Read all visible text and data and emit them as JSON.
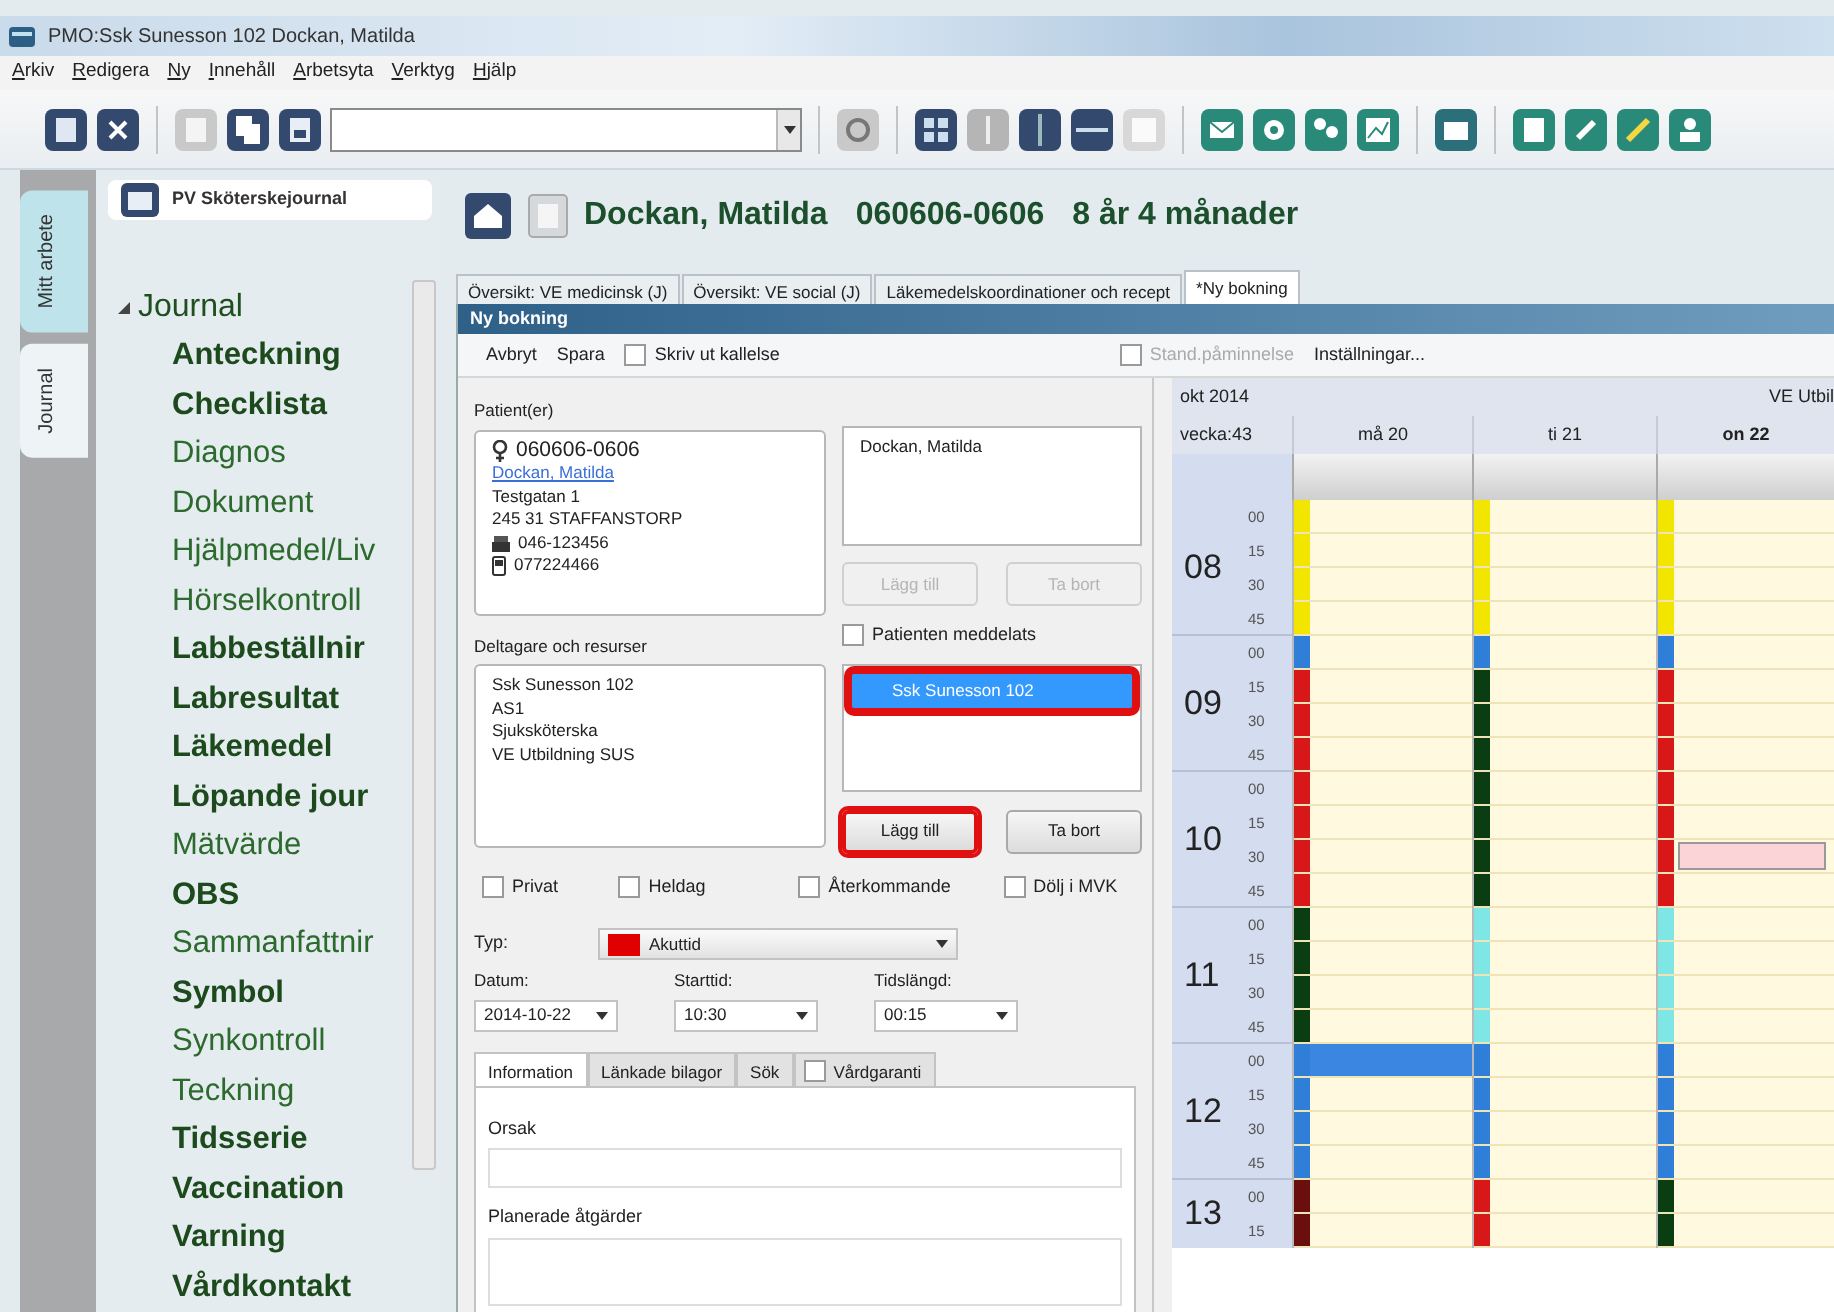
{
  "window": {
    "title": "PMO:Ssk Sunesson 102  Dockan, Matilda"
  },
  "menu": [
    "Arkiv",
    "Redigera",
    "Ny",
    "Innehåll",
    "Arbetsyta",
    "Verktyg",
    "Hjälp"
  ],
  "side_tabs": [
    {
      "label": "Mitt arbete",
      "selected": false
    },
    {
      "label": "Journal",
      "selected": true
    }
  ],
  "sidebar": {
    "title": "PV Sköterskejournal",
    "tree": [
      {
        "label": "Journal",
        "expanded": true,
        "children": [
          {
            "label": "Anteckning",
            "bold": true
          },
          {
            "label": "Checklista",
            "bold": true
          },
          {
            "label": "Diagnos",
            "bold": false
          },
          {
            "label": "Dokument",
            "bold": false
          },
          {
            "label": "Hjälpmedel/Liv",
            "bold": false
          },
          {
            "label": "Hörselkontroll",
            "bold": false
          },
          {
            "label": "Labbeställnir",
            "bold": true
          },
          {
            "label": "Labresultat",
            "bold": true
          },
          {
            "label": "Läkemedel",
            "bold": true
          },
          {
            "label": "Löpande jour",
            "bold": true
          },
          {
            "label": "Mätvärde",
            "bold": false
          },
          {
            "label": "OBS",
            "bold": true
          },
          {
            "label": "Sammanfattnir",
            "bold": false
          },
          {
            "label": "Symbol",
            "bold": true
          },
          {
            "label": "Synkontroll",
            "bold": false
          },
          {
            "label": "Teckning",
            "bold": false
          },
          {
            "label": "Tidsserie",
            "bold": true
          },
          {
            "label": "Vaccination",
            "bold": true
          },
          {
            "label": "Varning",
            "bold": true
          },
          {
            "label": "Vårdkontakt",
            "bold": true
          }
        ]
      }
    ]
  },
  "patient_header": {
    "name": "Dockan, Matilda",
    "id": "060606-0606",
    "age": "8 år 4 månader"
  },
  "tabs": [
    {
      "label": "Översikt: VE medicinsk (J)",
      "selected": false
    },
    {
      "label": "Översikt: VE social (J)",
      "selected": false
    },
    {
      "label": "Läkemedelskoordinationer och recept",
      "selected": false
    },
    {
      "label": "*Ny bokning",
      "selected": true
    }
  ],
  "dialog": {
    "title": "Ny bokning",
    "toolbar": [
      {
        "kind": "button",
        "label": "Avbryt"
      },
      {
        "kind": "button",
        "label": "Spara"
      },
      {
        "kind": "checkbox",
        "label": "Skriv ut kallelse",
        "checked": false,
        "disabled": false
      },
      {
        "kind": "checkbox",
        "label": "Stand.påminnelse",
        "checked": false,
        "disabled": true
      },
      {
        "kind": "button",
        "label": "Inställningar..."
      }
    ],
    "patients_label": "Patient(er)",
    "patient": {
      "id": "060606-0606",
      "name": "Dockan, Matilda",
      "address": "Testgatan 1",
      "city": "245 31 STAFFANSTORP",
      "phone": "046-123456",
      "mobile": "077224466"
    },
    "patient_list": [
      "Dockan, Matilda"
    ],
    "patient_buttons": [
      {
        "label": "Lägg till",
        "disabled": true,
        "highlighted": false
      },
      {
        "label": "Ta bort",
        "disabled": true,
        "highlighted": false
      }
    ],
    "patient_notified": {
      "label": "Patienten meddelats",
      "checked": false
    },
    "participants_label": "Deltagare och resurser",
    "participants": [
      "Ssk Sunesson 102",
      "AS1",
      "Sjuksköterska",
      "VE Utbildning SUS"
    ],
    "resource_list": [
      {
        "label": "Ssk Sunesson 102",
        "selected": true,
        "highlighted": true
      }
    ],
    "resource_buttons": [
      {
        "label": "Lägg till",
        "disabled": false,
        "highlighted": true
      },
      {
        "label": "Ta bort",
        "disabled": false,
        "highlighted": false
      }
    ],
    "options": [
      {
        "label": "Privat",
        "checked": false
      },
      {
        "label": "Heldag",
        "checked": false
      },
      {
        "label": "Återkommande",
        "checked": false
      },
      {
        "label": "Dölj i MVK",
        "checked": false
      }
    ],
    "type": {
      "label": "Typ:",
      "value": "Akuttid",
      "color": "#e00000"
    },
    "datetime": [
      {
        "label": "Datum:",
        "value": "2014-10-22"
      },
      {
        "label": "Starttid:",
        "value": "10:30"
      },
      {
        "label": "Tidslängd:",
        "value": "00:15"
      }
    ],
    "info_tabs": [
      {
        "label": "Information",
        "selected": true,
        "kind": "tab"
      },
      {
        "label": "Länkade bilagor",
        "selected": false,
        "kind": "tab"
      },
      {
        "label": "Sök",
        "selected": false,
        "kind": "tab"
      },
      {
        "label": "Vårdgaranti",
        "selected": false,
        "kind": "checkbox-tab",
        "checked": false
      }
    ],
    "fields": [
      {
        "label": "Orsak"
      },
      {
        "label": "Planerade åtgärder"
      }
    ]
  },
  "calendar": {
    "month": "okt 2014",
    "week": "vecka:43",
    "resource": "VE Utbil",
    "hours": [
      {
        "label": "08",
        "quarters": [
          "00",
          "15",
          "30",
          "45"
        ]
      },
      {
        "label": "09",
        "quarters": [
          "00",
          "15",
          "30",
          "45"
        ]
      },
      {
        "label": "10",
        "quarters": [
          "00",
          "15",
          "30",
          "45"
        ]
      },
      {
        "label": "11",
        "quarters": [
          "00",
          "15",
          "30",
          "45"
        ]
      },
      {
        "label": "12",
        "quarters": [
          "00",
          "15",
          "30",
          "45"
        ]
      },
      {
        "label": "13",
        "quarters": [
          "00",
          "15"
        ]
      }
    ],
    "days": [
      {
        "label": "må 20",
        "today": false,
        "slots": [
          {
            "color": "#f2e600"
          },
          {
            "color": "#f2e600"
          },
          {
            "color": "#f2e600"
          },
          {
            "color": "#f2e600"
          },
          {
            "color": "#2f7fd8"
          },
          {
            "color": "#d81818"
          },
          {
            "color": "#d81818"
          },
          {
            "color": "#d81818"
          },
          {
            "color": "#d81818"
          },
          {
            "color": "#d81818"
          },
          {
            "color": "#d81818"
          },
          {
            "color": "#d81818"
          },
          {
            "color": "#0b3d12"
          },
          {
            "color": "#0b3d12"
          },
          {
            "color": "#0b3d12"
          },
          {
            "color": "#0b3d12"
          },
          {
            "color": "#2f7fd8",
            "booking": {
              "color": "#3a86e0"
            }
          },
          {
            "color": "#2f7fd8"
          },
          {
            "color": "#2f7fd8"
          },
          {
            "color": "#2f7fd8"
          },
          {
            "color": "#6a0e0e"
          },
          {
            "color": "#6a0e0e"
          }
        ]
      },
      {
        "label": "ti 21",
        "today": false,
        "slots": [
          {
            "color": "#f2e600"
          },
          {
            "color": "#f2e600"
          },
          {
            "color": "#f2e600"
          },
          {
            "color": "#f2e600"
          },
          {
            "color": "#2f7fd8"
          },
          {
            "color": "#0b3d12"
          },
          {
            "color": "#0b3d12"
          },
          {
            "color": "#0b3d12"
          },
          {
            "color": "#0b3d12"
          },
          {
            "color": "#0b3d12"
          },
          {
            "color": "#0b3d12"
          },
          {
            "color": "#0b3d12"
          },
          {
            "color": "#7fe6e6"
          },
          {
            "color": "#7fe6e6"
          },
          {
            "color": "#7fe6e6"
          },
          {
            "color": "#7fe6e6"
          },
          {
            "color": "#2f7fd8"
          },
          {
            "color": "#2f7fd8"
          },
          {
            "color": "#2f7fd8"
          },
          {
            "color": "#2f7fd8"
          },
          {
            "color": "#d81818"
          },
          {
            "color": "#d81818"
          }
        ]
      },
      {
        "label": "on 22",
        "today": true,
        "slots": [
          {
            "color": "#f2e600"
          },
          {
            "color": "#f2e600"
          },
          {
            "color": "#f2e600"
          },
          {
            "color": "#f2e600"
          },
          {
            "color": "#2f7fd8"
          },
          {
            "color": "#d81818"
          },
          {
            "color": "#d81818"
          },
          {
            "color": "#d81818"
          },
          {
            "color": "#d81818"
          },
          {
            "color": "#d81818"
          },
          {
            "color": "#d81818",
            "booking": {
              "color": "#fbd4d8"
            }
          },
          {
            "color": "#d81818"
          },
          {
            "color": "#7fe6e6"
          },
          {
            "color": "#7fe6e6"
          },
          {
            "color": "#7fe6e6"
          },
          {
            "color": "#7fe6e6"
          },
          {
            "color": "#2f7fd8"
          },
          {
            "color": "#2f7fd8"
          },
          {
            "color": "#2f7fd8"
          },
          {
            "color": "#2f7fd8"
          },
          {
            "color": "#0b3d12"
          },
          {
            "color": "#0b3d12"
          }
        ]
      }
    ]
  }
}
